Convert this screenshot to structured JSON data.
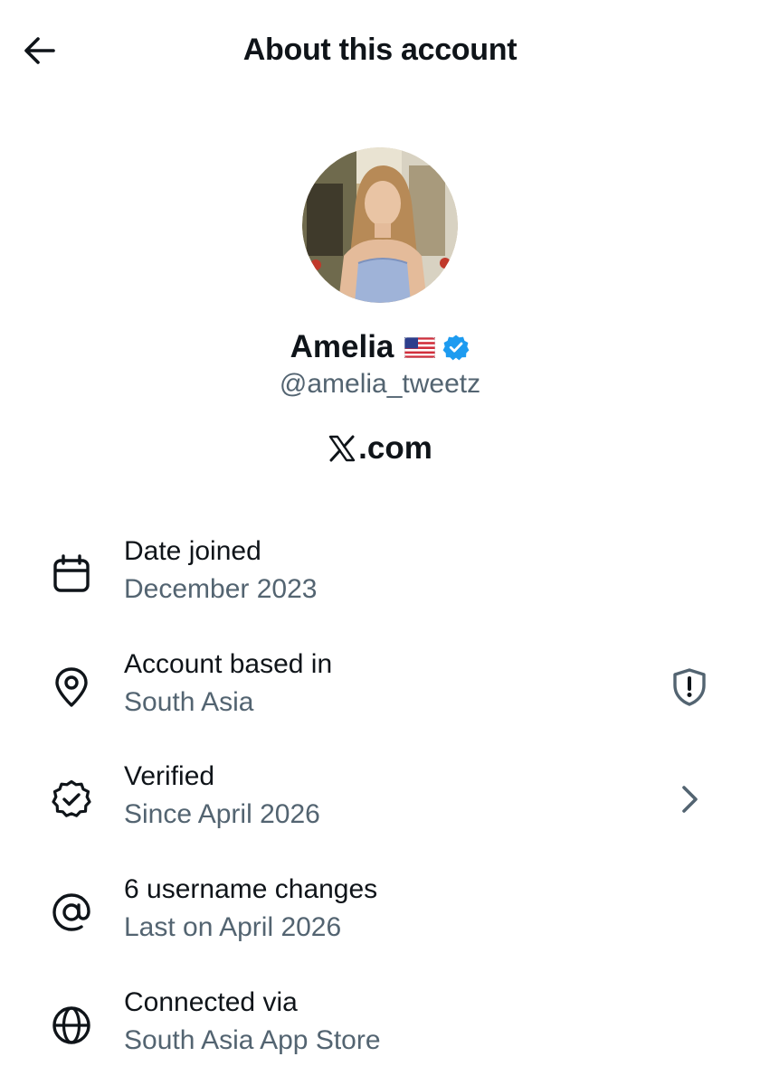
{
  "header": {
    "title": "About this account",
    "back_icon": "arrow-left-icon"
  },
  "profile": {
    "name": "Amelia",
    "flag_icon": "us-flag-icon",
    "verified_icon": "verified-badge-icon",
    "verified_color": "#1d9bf0",
    "handle": "@amelia_tweetz",
    "site": ".com",
    "site_logo_icon": "x-logo-icon"
  },
  "colors": {
    "primary_text": "#0f1419",
    "secondary_text": "#536471",
    "icon_gray": "#536471"
  },
  "rows": [
    {
      "icon": "calendar-icon",
      "title": "Date joined",
      "subtitle": "December 2023"
    },
    {
      "icon": "location-pin-icon",
      "title": "Account based in",
      "subtitle": "South Asia",
      "action_icon": "shield-alert-icon"
    },
    {
      "icon": "verified-outline-icon",
      "title": "Verified",
      "subtitle": "Since April 2026",
      "action_icon": "chevron-right-icon"
    },
    {
      "icon": "at-sign-icon",
      "title": "6 username changes",
      "subtitle": "Last on April 2026"
    },
    {
      "icon": "globe-icon",
      "title": "Connected via",
      "subtitle": "South Asia App Store"
    }
  ]
}
